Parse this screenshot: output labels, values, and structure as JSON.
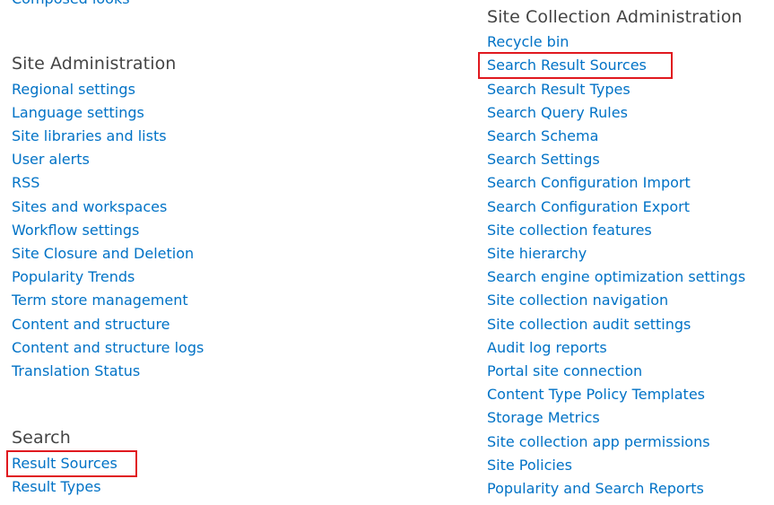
{
  "left_column": {
    "top_cut_link": "Composed looks",
    "site_administration": {
      "heading": "Site Administration",
      "links": [
        "Regional settings",
        "Language settings",
        "Site libraries and lists",
        "User alerts",
        "RSS",
        "Sites and workspaces",
        "Workflow settings",
        "Site Closure and Deletion",
        "Popularity Trends",
        "Term store management",
        "Content and structure",
        "Content and structure logs",
        "Translation Status"
      ]
    },
    "search": {
      "heading": "Search",
      "links": [
        "Result Sources",
        "Result Types"
      ]
    }
  },
  "right_column": {
    "site_collection_administration": {
      "heading": "Site Collection Administration",
      "links": [
        "Recycle bin",
        "Search Result Sources",
        "Search Result Types",
        "Search Query Rules",
        "Search Schema",
        "Search Settings",
        "Search Configuration Import",
        "Search Configuration Export",
        "Site collection features",
        "Site hierarchy",
        "Search engine optimization settings",
        "Site collection navigation",
        "Site collection audit settings",
        "Audit log reports",
        "Portal site connection",
        "Content Type Policy Templates",
        "Storage Metrics",
        "Site collection app permissions",
        "Site Policies",
        "Popularity and Search Reports"
      ]
    }
  },
  "colors": {
    "link": "#0072c6",
    "heading": "#444444",
    "highlight_border": "#e0191f"
  }
}
